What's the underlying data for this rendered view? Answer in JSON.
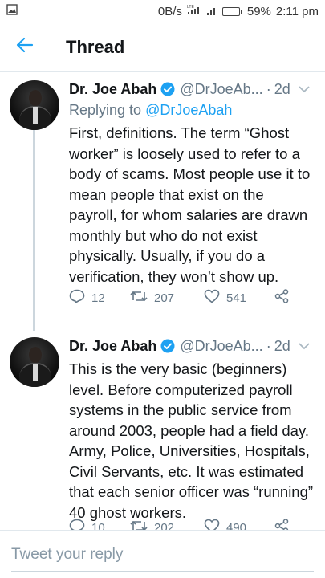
{
  "status_bar": {
    "net_speed": "0B/s",
    "battery": "59%",
    "battery_level": 0.59,
    "time": "2:11 pm"
  },
  "header": {
    "title": "Thread"
  },
  "tweets": [
    {
      "name": "Dr. Joe Abah",
      "handle": "@DrJoeAb...",
      "time": "2d",
      "reply_prefix": "Replying to ",
      "reply_to": "@DrJoeAbah",
      "text": "First, definitions. The term “Ghost worker” is loosely used to refer to a body of scams. Most people use it to mean people that exist on the payroll, for whom salaries are drawn monthly but who do not exist physically. Usually, if you do a verification, they won’t show up.",
      "replies": "12",
      "retweets": "207",
      "likes": "541"
    },
    {
      "name": "Dr. Joe Abah",
      "handle": "@DrJoeAb...",
      "time": "2d",
      "text": "This is the very basic (beginners) level. Before computerized payroll systems in the public service from around 2003, people had a field day. Army, Police, Universities, Hospitals, Civil Servants, etc. It was estimated that each senior officer was “running” 40 ghost workers.",
      "replies": "10",
      "retweets": "202",
      "likes": "490"
    }
  ],
  "compose": {
    "placeholder": "Tweet your reply"
  },
  "colors": {
    "accent": "#1da1f2",
    "text": "#14171a",
    "muted": "#657786"
  }
}
